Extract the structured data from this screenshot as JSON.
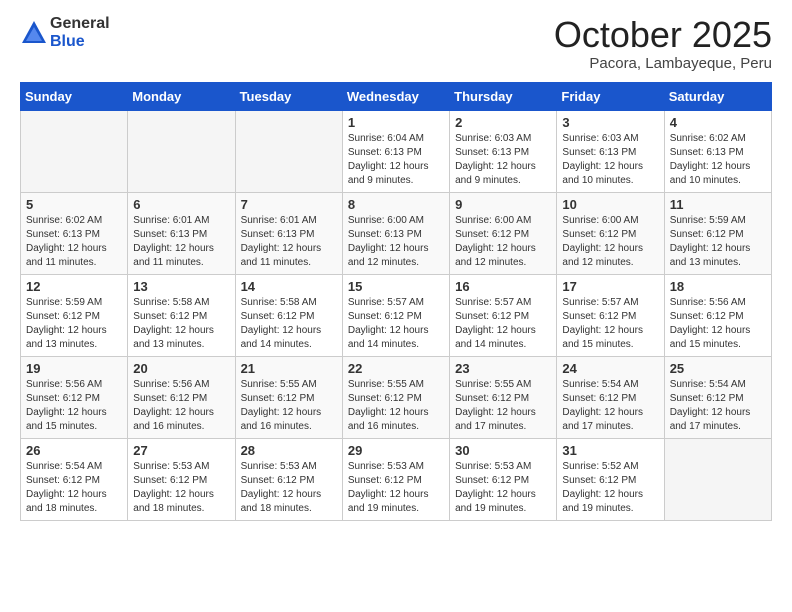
{
  "logo": {
    "general": "General",
    "blue": "Blue"
  },
  "title": "October 2025",
  "location": "Pacora, Lambayeque, Peru",
  "weekdays": [
    "Sunday",
    "Monday",
    "Tuesday",
    "Wednesday",
    "Thursday",
    "Friday",
    "Saturday"
  ],
  "weeks": [
    [
      {
        "day": "",
        "info": ""
      },
      {
        "day": "",
        "info": ""
      },
      {
        "day": "",
        "info": ""
      },
      {
        "day": "1",
        "info": "Sunrise: 6:04 AM\nSunset: 6:13 PM\nDaylight: 12 hours and 9 minutes."
      },
      {
        "day": "2",
        "info": "Sunrise: 6:03 AM\nSunset: 6:13 PM\nDaylight: 12 hours and 9 minutes."
      },
      {
        "day": "3",
        "info": "Sunrise: 6:03 AM\nSunset: 6:13 PM\nDaylight: 12 hours and 10 minutes."
      },
      {
        "day": "4",
        "info": "Sunrise: 6:02 AM\nSunset: 6:13 PM\nDaylight: 12 hours and 10 minutes."
      }
    ],
    [
      {
        "day": "5",
        "info": "Sunrise: 6:02 AM\nSunset: 6:13 PM\nDaylight: 12 hours and 11 minutes."
      },
      {
        "day": "6",
        "info": "Sunrise: 6:01 AM\nSunset: 6:13 PM\nDaylight: 12 hours and 11 minutes."
      },
      {
        "day": "7",
        "info": "Sunrise: 6:01 AM\nSunset: 6:13 PM\nDaylight: 12 hours and 11 minutes."
      },
      {
        "day": "8",
        "info": "Sunrise: 6:00 AM\nSunset: 6:13 PM\nDaylight: 12 hours and 12 minutes."
      },
      {
        "day": "9",
        "info": "Sunrise: 6:00 AM\nSunset: 6:12 PM\nDaylight: 12 hours and 12 minutes."
      },
      {
        "day": "10",
        "info": "Sunrise: 6:00 AM\nSunset: 6:12 PM\nDaylight: 12 hours and 12 minutes."
      },
      {
        "day": "11",
        "info": "Sunrise: 5:59 AM\nSunset: 6:12 PM\nDaylight: 12 hours and 13 minutes."
      }
    ],
    [
      {
        "day": "12",
        "info": "Sunrise: 5:59 AM\nSunset: 6:12 PM\nDaylight: 12 hours and 13 minutes."
      },
      {
        "day": "13",
        "info": "Sunrise: 5:58 AM\nSunset: 6:12 PM\nDaylight: 12 hours and 13 minutes."
      },
      {
        "day": "14",
        "info": "Sunrise: 5:58 AM\nSunset: 6:12 PM\nDaylight: 12 hours and 14 minutes."
      },
      {
        "day": "15",
        "info": "Sunrise: 5:57 AM\nSunset: 6:12 PM\nDaylight: 12 hours and 14 minutes."
      },
      {
        "day": "16",
        "info": "Sunrise: 5:57 AM\nSunset: 6:12 PM\nDaylight: 12 hours and 14 minutes."
      },
      {
        "day": "17",
        "info": "Sunrise: 5:57 AM\nSunset: 6:12 PM\nDaylight: 12 hours and 15 minutes."
      },
      {
        "day": "18",
        "info": "Sunrise: 5:56 AM\nSunset: 6:12 PM\nDaylight: 12 hours and 15 minutes."
      }
    ],
    [
      {
        "day": "19",
        "info": "Sunrise: 5:56 AM\nSunset: 6:12 PM\nDaylight: 12 hours and 15 minutes."
      },
      {
        "day": "20",
        "info": "Sunrise: 5:56 AM\nSunset: 6:12 PM\nDaylight: 12 hours and 16 minutes."
      },
      {
        "day": "21",
        "info": "Sunrise: 5:55 AM\nSunset: 6:12 PM\nDaylight: 12 hours and 16 minutes."
      },
      {
        "day": "22",
        "info": "Sunrise: 5:55 AM\nSunset: 6:12 PM\nDaylight: 12 hours and 16 minutes."
      },
      {
        "day": "23",
        "info": "Sunrise: 5:55 AM\nSunset: 6:12 PM\nDaylight: 12 hours and 17 minutes."
      },
      {
        "day": "24",
        "info": "Sunrise: 5:54 AM\nSunset: 6:12 PM\nDaylight: 12 hours and 17 minutes."
      },
      {
        "day": "25",
        "info": "Sunrise: 5:54 AM\nSunset: 6:12 PM\nDaylight: 12 hours and 17 minutes."
      }
    ],
    [
      {
        "day": "26",
        "info": "Sunrise: 5:54 AM\nSunset: 6:12 PM\nDaylight: 12 hours and 18 minutes."
      },
      {
        "day": "27",
        "info": "Sunrise: 5:53 AM\nSunset: 6:12 PM\nDaylight: 12 hours and 18 minutes."
      },
      {
        "day": "28",
        "info": "Sunrise: 5:53 AM\nSunset: 6:12 PM\nDaylight: 12 hours and 18 minutes."
      },
      {
        "day": "29",
        "info": "Sunrise: 5:53 AM\nSunset: 6:12 PM\nDaylight: 12 hours and 19 minutes."
      },
      {
        "day": "30",
        "info": "Sunrise: 5:53 AM\nSunset: 6:12 PM\nDaylight: 12 hours and 19 minutes."
      },
      {
        "day": "31",
        "info": "Sunrise: 5:52 AM\nSunset: 6:12 PM\nDaylight: 12 hours and 19 minutes."
      },
      {
        "day": "",
        "info": ""
      }
    ]
  ]
}
